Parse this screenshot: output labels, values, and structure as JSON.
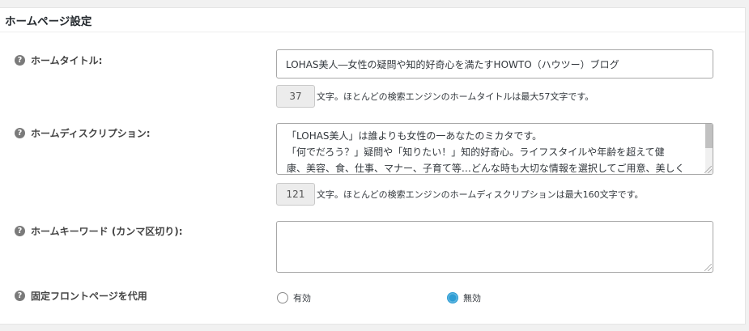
{
  "panel": {
    "title": "ホームページ設定"
  },
  "icons": {
    "help": "question-mark-icon"
  },
  "fields": {
    "home_title": {
      "label": "ホームタイトル:",
      "value": "LOHAS美人―女性の疑問や知的好奇心を満たすHOWTO（ハウツー）ブログ",
      "count": "37",
      "count_note": "文字。ほとんどの検索エンジンのホームタイトルは最大57文字です。"
    },
    "home_description": {
      "label": "ホームディスクリプション:",
      "value": "「LOHAS美人」は誰よりも女性の一あなたのミカタです。\n「何でだろう？」疑問や「知りたい！」知的好奇心。ライフスタイルや年齢を超えて健\n康、美容、食、仕事、マナー、子育て等…どんな時も大切な情報を選択してご用意、美しく",
      "count": "121",
      "count_note": "文字。ほとんどの検索エンジンのホームディスクリプションは最大160文字です。"
    },
    "home_keywords": {
      "label": "ホームキーワード (カンマ区切り):",
      "value": ""
    },
    "static_front": {
      "label": "固定フロントページを代用",
      "options": [
        "有効",
        "無効"
      ],
      "selected": "無効"
    }
  },
  "colors": {
    "radio_checked": "#2e9dd4",
    "help_icon": "#7a7a7a"
  }
}
